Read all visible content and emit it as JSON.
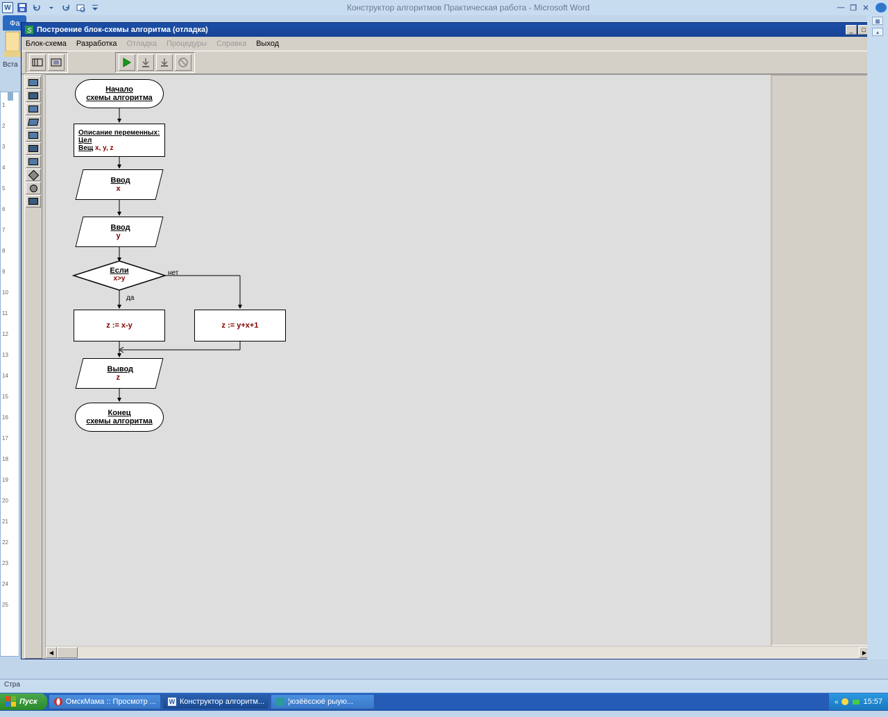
{
  "word": {
    "title": "Конструктор алгоритмов Практическая работа - Microsoft Word",
    "tab_file": "Фа",
    "vsta": "Вста",
    "status": "Стра"
  },
  "inner": {
    "title": "Построение блок-схемы алгоритма (отладка)",
    "menu": {
      "scheme": "Блок-схема",
      "dev": "Разработка",
      "debug": "Отладка",
      "proc": "Процедуры",
      "help": "Справка",
      "exit": "Выход"
    }
  },
  "flow": {
    "start1": "Начало",
    "start2": "схемы алгоритма",
    "decl_h": "Описание переменных:",
    "decl_t1": "Цел",
    "decl_t2": "Вещ",
    "decl_v2": "x, y, z",
    "in1_h": "Ввод",
    "in1_v": "x",
    "in2_h": "Ввод",
    "in2_v": "y",
    "cond_h": "Если",
    "cond_v": "x>y",
    "cond_yes": "да",
    "cond_no": "нет",
    "p_left": "z := x-y",
    "p_right": "z := y+x+1",
    "out_h": "Вывод",
    "out_v": "z",
    "end1": "Конец",
    "end2": "схемы алгоритма"
  },
  "taskbar": {
    "start": "Пуск",
    "t1": "ОмскМама :: Просмотр ...",
    "t2": "Конструктор алгоритм...",
    "t3": "¦юзёёєсюё рыую...",
    "clock": "15:57"
  },
  "ruler_numbers": [
    "1",
    "2",
    "3",
    "4",
    "5",
    "6",
    "7",
    "8",
    "9",
    "10",
    "11",
    "12",
    "13",
    "14",
    "15",
    "16",
    "17",
    "18",
    "19",
    "20",
    "21",
    "22",
    "23",
    "24",
    "25"
  ]
}
